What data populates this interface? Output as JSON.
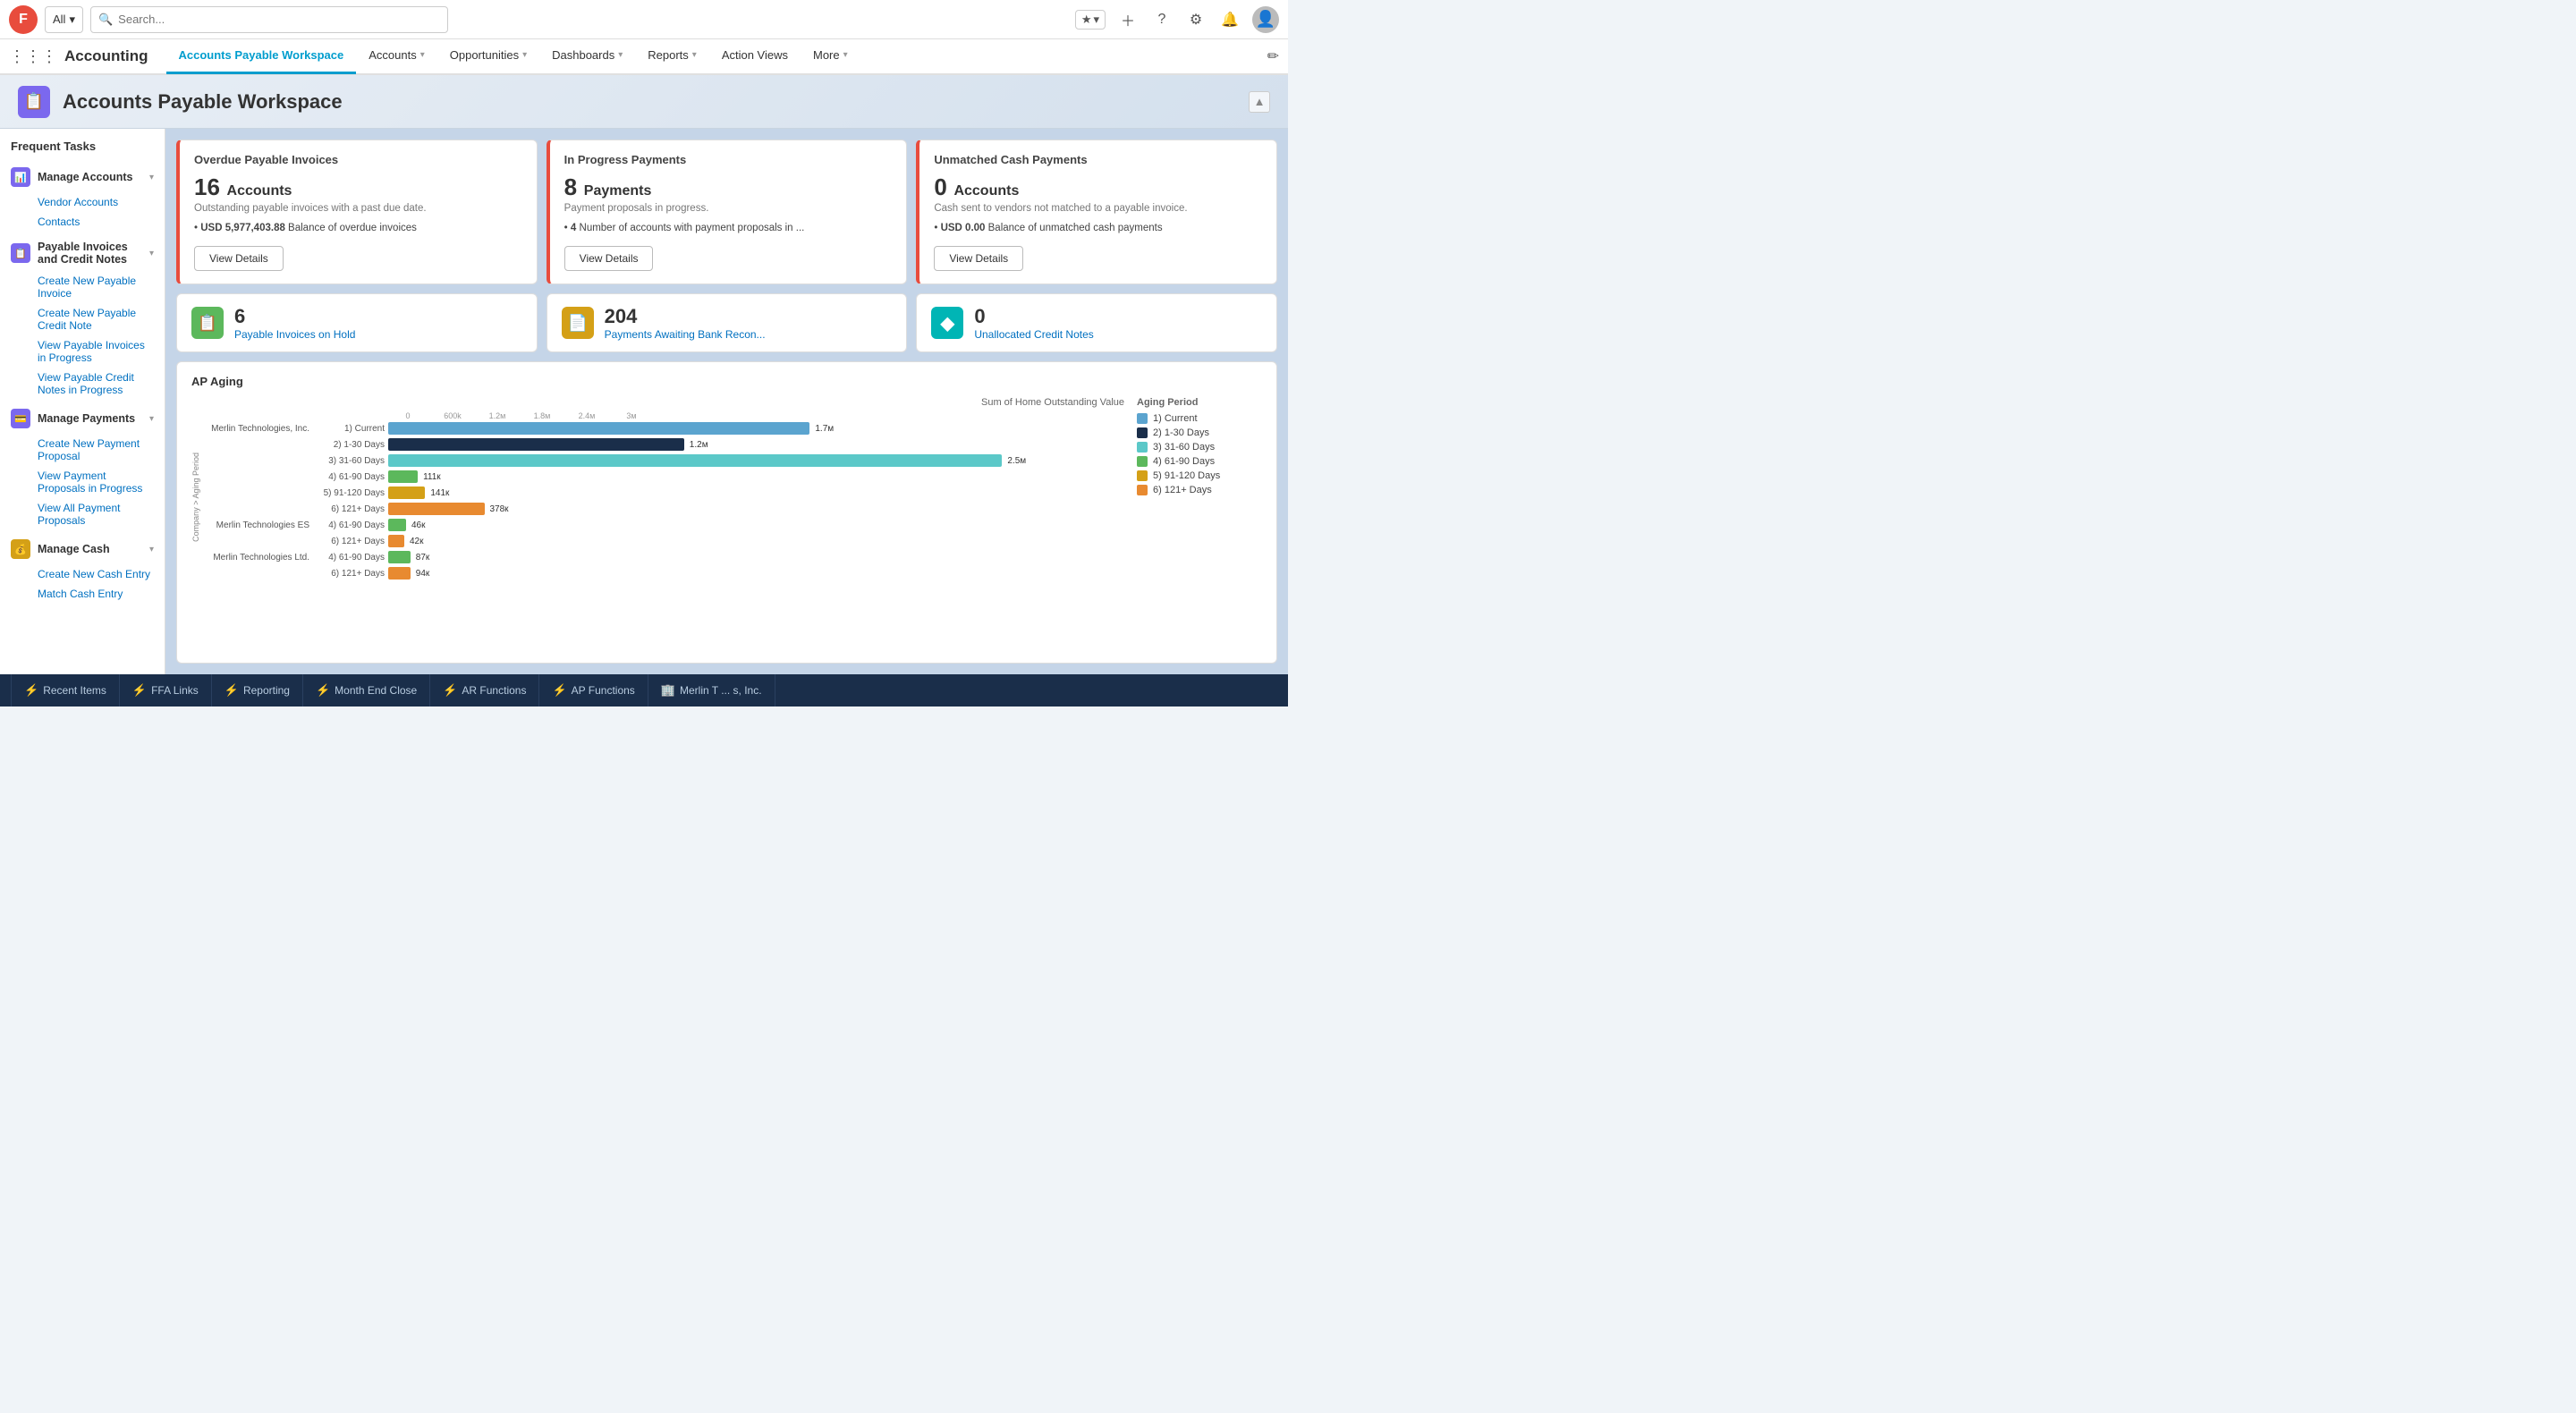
{
  "app": {
    "logo": "F",
    "title": "Accounting"
  },
  "search": {
    "all_label": "All",
    "placeholder": "Search..."
  },
  "nav": {
    "items": [
      {
        "label": "Accounts Payable Workspace",
        "active": true,
        "has_chevron": false
      },
      {
        "label": "Accounts",
        "active": false,
        "has_chevron": true
      },
      {
        "label": "Opportunities",
        "active": false,
        "has_chevron": true
      },
      {
        "label": "Dashboards",
        "active": false,
        "has_chevron": true
      },
      {
        "label": "Reports",
        "active": false,
        "has_chevron": true
      },
      {
        "label": "Action Views",
        "active": false,
        "has_chevron": false
      },
      {
        "label": "More",
        "active": false,
        "has_chevron": true
      }
    ]
  },
  "page": {
    "title": "Accounts Payable Workspace",
    "icon": "📋"
  },
  "sidebar": {
    "title": "Frequent Tasks",
    "sections": [
      {
        "label": "Manage Accounts",
        "icon_color": "purple",
        "expanded": true,
        "items": [
          "Vendor Accounts",
          "Contacts"
        ]
      },
      {
        "label": "Payable Invoices and Credit Notes",
        "icon_color": "purple",
        "expanded": true,
        "items": [
          "Create New Payable Invoice",
          "Create New Payable Credit Note",
          "View Payable Invoices in Progress",
          "View Payable Credit Notes in Progress"
        ]
      },
      {
        "label": "Manage Payments",
        "icon_color": "purple",
        "expanded": true,
        "items": [
          "Create New Payment Proposal",
          "View Payment Proposals in Progress",
          "View All Payment Proposals"
        ]
      },
      {
        "label": "Manage Cash",
        "icon_color": "gold",
        "expanded": true,
        "items": [
          "Create New Cash Entry",
          "Match Cash Entry"
        ]
      }
    ]
  },
  "cards": [
    {
      "title": "Overdue Payable Invoices",
      "number": "16",
      "number_label": "Accounts",
      "desc": "Outstanding payable invoices with a past due date.",
      "detail": "USD 5,977,403.88 Balance of overdue invoices",
      "btn": "View Details",
      "alert": true
    },
    {
      "title": "In Progress Payments",
      "number": "8",
      "number_label": "Payments",
      "desc": "Payment proposals in progress.",
      "detail": "4 Number of accounts with payment proposals in ...",
      "btn": "View Details",
      "alert": true
    },
    {
      "title": "Unmatched Cash Payments",
      "number": "0",
      "number_label": "Accounts",
      "desc": "Cash sent to vendors not matched to a payable invoice.",
      "detail": "USD 0.00 Balance of unmatched cash payments",
      "btn": "View Details",
      "alert": true
    }
  ],
  "quick_stats": [
    {
      "icon": "📋",
      "icon_color": "green",
      "number": "6",
      "label": "Payable Invoices on Hold"
    },
    {
      "icon": "📄",
      "icon_color": "gold",
      "number": "204",
      "label": "Payments Awaiting Bank Recon..."
    },
    {
      "icon": "◆",
      "icon_color": "teal",
      "number": "0",
      "label": "Unallocated Credit Notes"
    }
  ],
  "ap_aging": {
    "title": "AP Aging",
    "axis_title": "Sum of Home Outstanding Value",
    "y_axis_title": "Company > Aging Period",
    "legend_title": "Aging Period",
    "axis_values": [
      "0",
      "600k",
      "1.2м",
      "1.8м",
      "2.4м",
      "3м"
    ],
    "legend": [
      {
        "label": "1) Current",
        "color": "#5ba4cf"
      },
      {
        "label": "2) 1-30 Days",
        "color": "#1a2e4a"
      },
      {
        "label": "3) 31-60 Days",
        "color": "#5bc8c8"
      },
      {
        "label": "4) 61-90 Days",
        "color": "#5cb85c"
      },
      {
        "label": "5) 91-120 Days",
        "color": "#d4a017"
      },
      {
        "label": "6) 121+ Days",
        "color": "#e88a30"
      }
    ],
    "bars": [
      {
        "company": "Merlin Technologies, Inc.",
        "period": "1) Current",
        "value": 1700000,
        "label": "1.7м",
        "color": "#5ba4cf",
        "width_pct": 57
      },
      {
        "company": "",
        "period": "2) 1-30 Days",
        "value": 1200000,
        "label": "1.2м",
        "color": "#1a2e4a",
        "width_pct": 40
      },
      {
        "company": "",
        "period": "3) 31-60 Days",
        "value": 2500000,
        "label": "2.5м",
        "color": "#5bc8c8",
        "width_pct": 83
      },
      {
        "company": "",
        "period": "4) 61-90 Days",
        "value": 111000,
        "label": "111к",
        "color": "#5cb85c",
        "width_pct": 4
      },
      {
        "company": "",
        "period": "5) 91-120 Days",
        "value": 141000,
        "label": "141к",
        "color": "#d4a017",
        "width_pct": 5
      },
      {
        "company": "",
        "period": "6) 121+ Days",
        "value": 378000,
        "label": "378к",
        "color": "#e88a30",
        "width_pct": 13
      },
      {
        "company": "Merlin Technologies ES",
        "period": "4) 61-90 Days",
        "value": 46000,
        "label": "46к",
        "color": "#5cb85c",
        "width_pct": 2
      },
      {
        "company": "",
        "period": "6) 121+ Days",
        "value": 42000,
        "label": "42к",
        "color": "#e88a30",
        "width_pct": 1
      },
      {
        "company": "Merlin Technologies Ltd.",
        "period": "4) 61-90 Days",
        "value": 87000,
        "label": "87к",
        "color": "#5cb85c",
        "width_pct": 3
      },
      {
        "company": "",
        "period": "6) 121+ Days",
        "value": 94000,
        "label": "94к",
        "color": "#e88a30",
        "width_pct": 3
      }
    ]
  },
  "bottom_bar": {
    "items": [
      {
        "icon": "⚡",
        "label": "Recent Items"
      },
      {
        "icon": "⚡",
        "label": "FFA Links"
      },
      {
        "icon": "⚡",
        "label": "Reporting"
      },
      {
        "icon": "⚡",
        "label": "Month End Close"
      },
      {
        "icon": "⚡",
        "label": "AR Functions"
      },
      {
        "icon": "⚡",
        "label": "AP Functions"
      },
      {
        "icon": "🏢",
        "label": "Merlin T ... s, Inc."
      }
    ]
  }
}
